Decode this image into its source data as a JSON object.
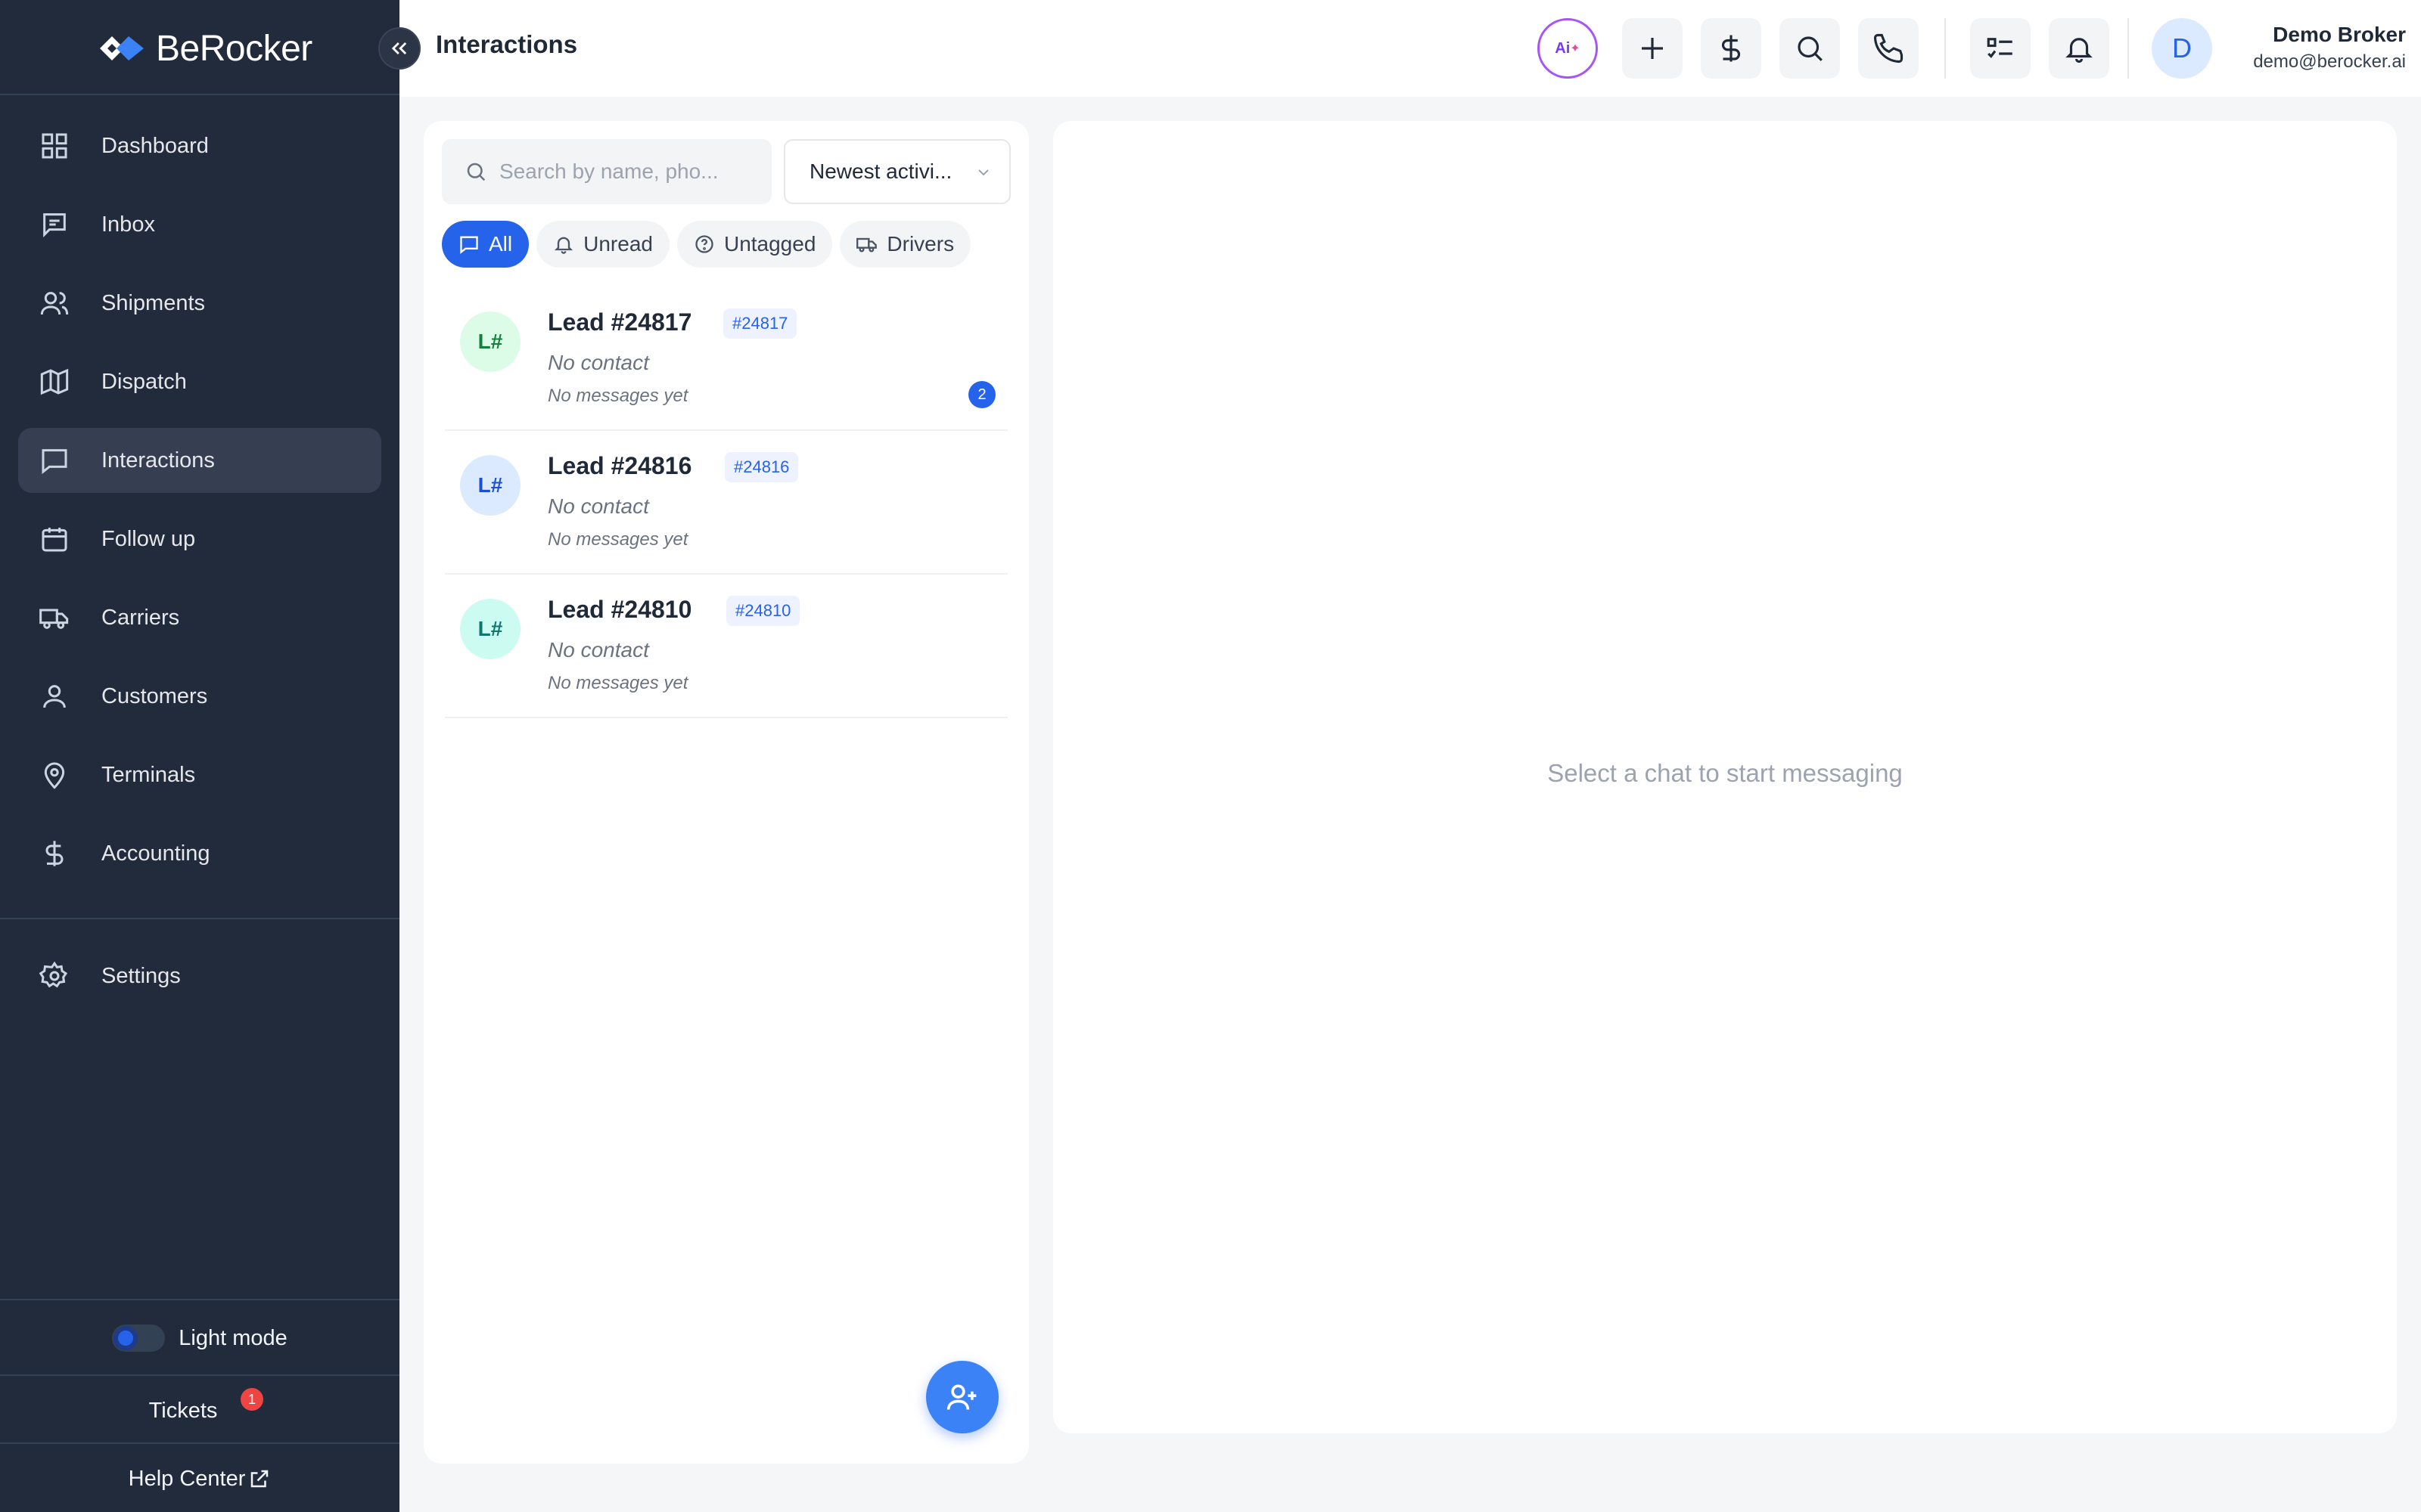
{
  "app": {
    "brand": "BeRocker"
  },
  "sidebar": {
    "items": [
      {
        "label": "Dashboard",
        "icon": "grid-icon"
      },
      {
        "label": "Inbox",
        "icon": "message-square-icon"
      },
      {
        "label": "Shipments",
        "icon": "users-icon"
      },
      {
        "label": "Dispatch",
        "icon": "map-icon"
      },
      {
        "label": "Interactions",
        "icon": "chat-icon",
        "active": true
      },
      {
        "label": "Follow up",
        "icon": "calendar-icon"
      },
      {
        "label": "Carriers",
        "icon": "truck-icon"
      },
      {
        "label": "Customers",
        "icon": "user-icon"
      },
      {
        "label": "Terminals",
        "icon": "map-pin-icon"
      },
      {
        "label": "Accounting",
        "icon": "dollar-icon"
      }
    ],
    "settings_label": "Settings",
    "light_mode_label": "Light mode",
    "tickets_label": "Tickets",
    "tickets_badge": "1",
    "help_center_label": "Help Center"
  },
  "header": {
    "title": "Interactions",
    "ai_label": "Ai",
    "user_initial": "D",
    "user_name": "Demo Broker",
    "user_email": "demo@berocker.ai"
  },
  "list": {
    "search_placeholder": "Search by name, pho...",
    "sort_value": "Newest activi...",
    "filters": [
      {
        "label": "All",
        "icon": "chat-icon",
        "active": true
      },
      {
        "label": "Unread",
        "icon": "bell-icon"
      },
      {
        "label": "Untagged",
        "icon": "help-circle-icon"
      },
      {
        "label": "Drivers",
        "icon": "truck-icon"
      }
    ],
    "leads": [
      {
        "initials": "L#",
        "title": "Lead #24817",
        "tag": "#24817",
        "contact": "No contact",
        "last_message": "No messages yet",
        "unread": "2",
        "avatar_bg": "#dcfce7",
        "avatar_fg": "#15803d"
      },
      {
        "initials": "L#",
        "title": "Lead #24816",
        "tag": "#24816",
        "contact": "No contact",
        "last_message": "No messages yet",
        "unread": "",
        "avatar_bg": "#dbeafe",
        "avatar_fg": "#1d4ed8"
      },
      {
        "initials": "L#",
        "title": "Lead #24810",
        "tag": "#24810",
        "contact": "No contact",
        "last_message": "No messages yet",
        "unread": "",
        "avatar_bg": "#ccfbf1",
        "avatar_fg": "#0f766e"
      }
    ]
  },
  "chat": {
    "empty_message": "Select a chat to start messaging"
  },
  "colors": {
    "accent": "#2563eb",
    "sidebar_bg": "#222b3b",
    "ai_border": "#a855f7",
    "danger": "#ef4444"
  }
}
